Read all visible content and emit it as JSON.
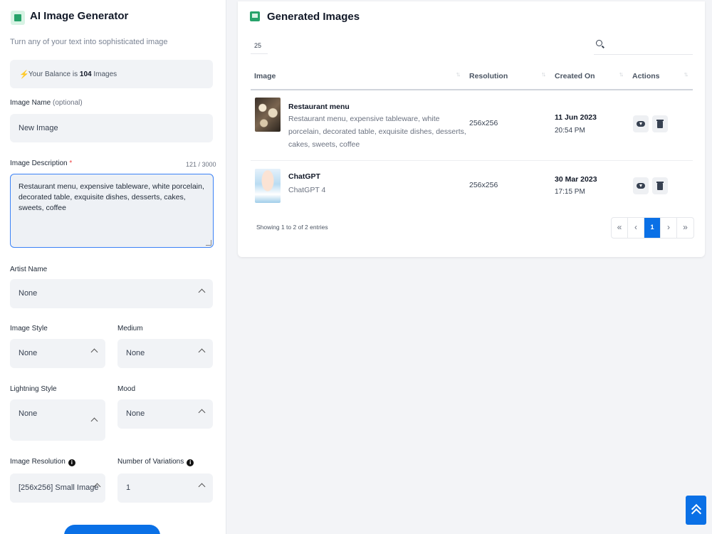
{
  "generator": {
    "title": "AI Image Generator",
    "subtitle": "Turn any of your text into sophisticated image",
    "balance_prefix": "Your Balance is",
    "balance_count": "104",
    "balance_suffix": "Images",
    "image_name_label": "Image Name",
    "image_name_optional": "(optional)",
    "image_name_value": "New Image",
    "desc_label": "Image Description",
    "desc_required": "*",
    "desc_counter": "121 / 3000",
    "desc_value": "Restaurant menu, expensive tableware, white porcelain, decorated table, exquisite dishes, desserts, cakes, sweets, coffee",
    "artist_label": "Artist Name",
    "artist_value": "None",
    "style_label": "Image Style",
    "style_value": "None",
    "medium_label": "Medium",
    "medium_value": "None",
    "lighting_label": "Lightning Style",
    "lighting_value": "None",
    "mood_label": "Mood",
    "mood_value": "None",
    "resolution_label": "Image Resolution",
    "resolution_value": "[256x256] Small Image",
    "variations_label": "Number of Variations",
    "variations_value": "1"
  },
  "results": {
    "title": "Generated Images",
    "page_length": "25",
    "search_placeholder": "",
    "columns": [
      "Image",
      "Resolution",
      "Created On",
      "Actions"
    ],
    "rows": [
      {
        "title": "Restaurant menu",
        "description": "Restaurant menu, expensive tableware, white porcelain, decorated table, exquisite dishes, desserts, cakes, sweets, coffee",
        "resolution": "256x256",
        "date": "11 Jun 2023",
        "time": "20:54 PM"
      },
      {
        "title": "ChatGPT",
        "description": "ChatGPT 4",
        "resolution": "256x256",
        "date": "30 Mar 2023",
        "time": "17:15 PM"
      }
    ],
    "info": "Showing 1 to 2 of 2 entries",
    "pagination": {
      "first": "«",
      "prev": "‹",
      "current": "1",
      "next": "›",
      "last": "»"
    }
  },
  "colors": {
    "accent": "#0a70e6",
    "icon_green": "#27a36a",
    "required": "#ef4444"
  },
  "icons": [
    "image-icon",
    "bolt-icon",
    "search-icon",
    "sort-icon",
    "chevron-up-icon",
    "info-icon",
    "cloud-download-icon",
    "trash-icon",
    "double-chevron-up-icon"
  ]
}
